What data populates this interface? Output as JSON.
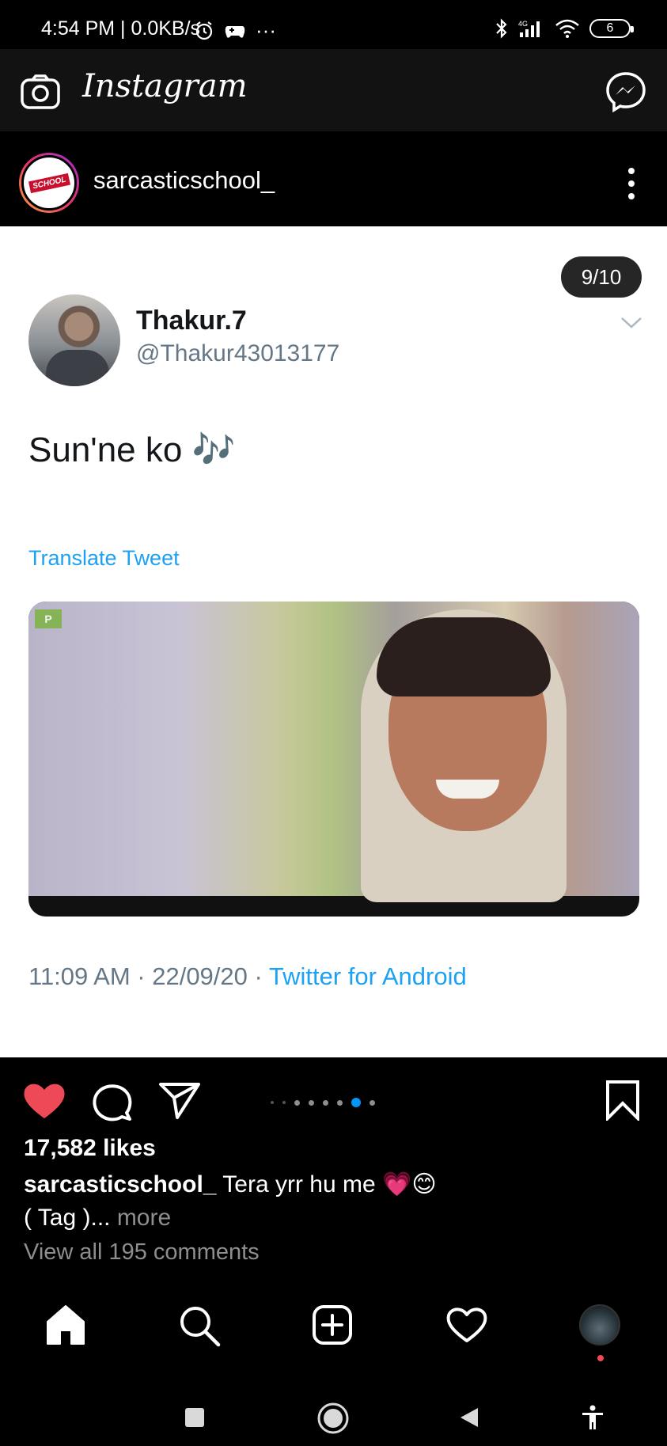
{
  "status_bar": {
    "time_speed": "4:54 PM | 0.0KB/s",
    "more": "···",
    "battery": "6"
  },
  "app_header": {
    "brand": "Instagram"
  },
  "post": {
    "username": "sarcasticschool_",
    "avatar_badge": "SCHOOL",
    "page_counter": "9/10",
    "carousel": {
      "total": 10,
      "current": 9
    },
    "tweet": {
      "name": "Thakur.7",
      "handle": "@Thakur43013177",
      "text": "Sun'ne ko 🎶",
      "translate_label": "Translate Tweet",
      "timestamp": "11:09 AM · 22/09/20 · ",
      "source": "Twitter for Android",
      "media_logo": "P"
    },
    "likes": "17,582 likes",
    "caption_user": "sarcasticschool_",
    "caption_text": " Tera yrr hu me 💗😊",
    "caption_tag": "( Tag )...",
    "caption_more": " more",
    "view_comments": "View all 195 comments"
  },
  "colors": {
    "like_red": "#ed4956",
    "link_blue": "#1da1f2",
    "active_dot": "#0095f6"
  }
}
